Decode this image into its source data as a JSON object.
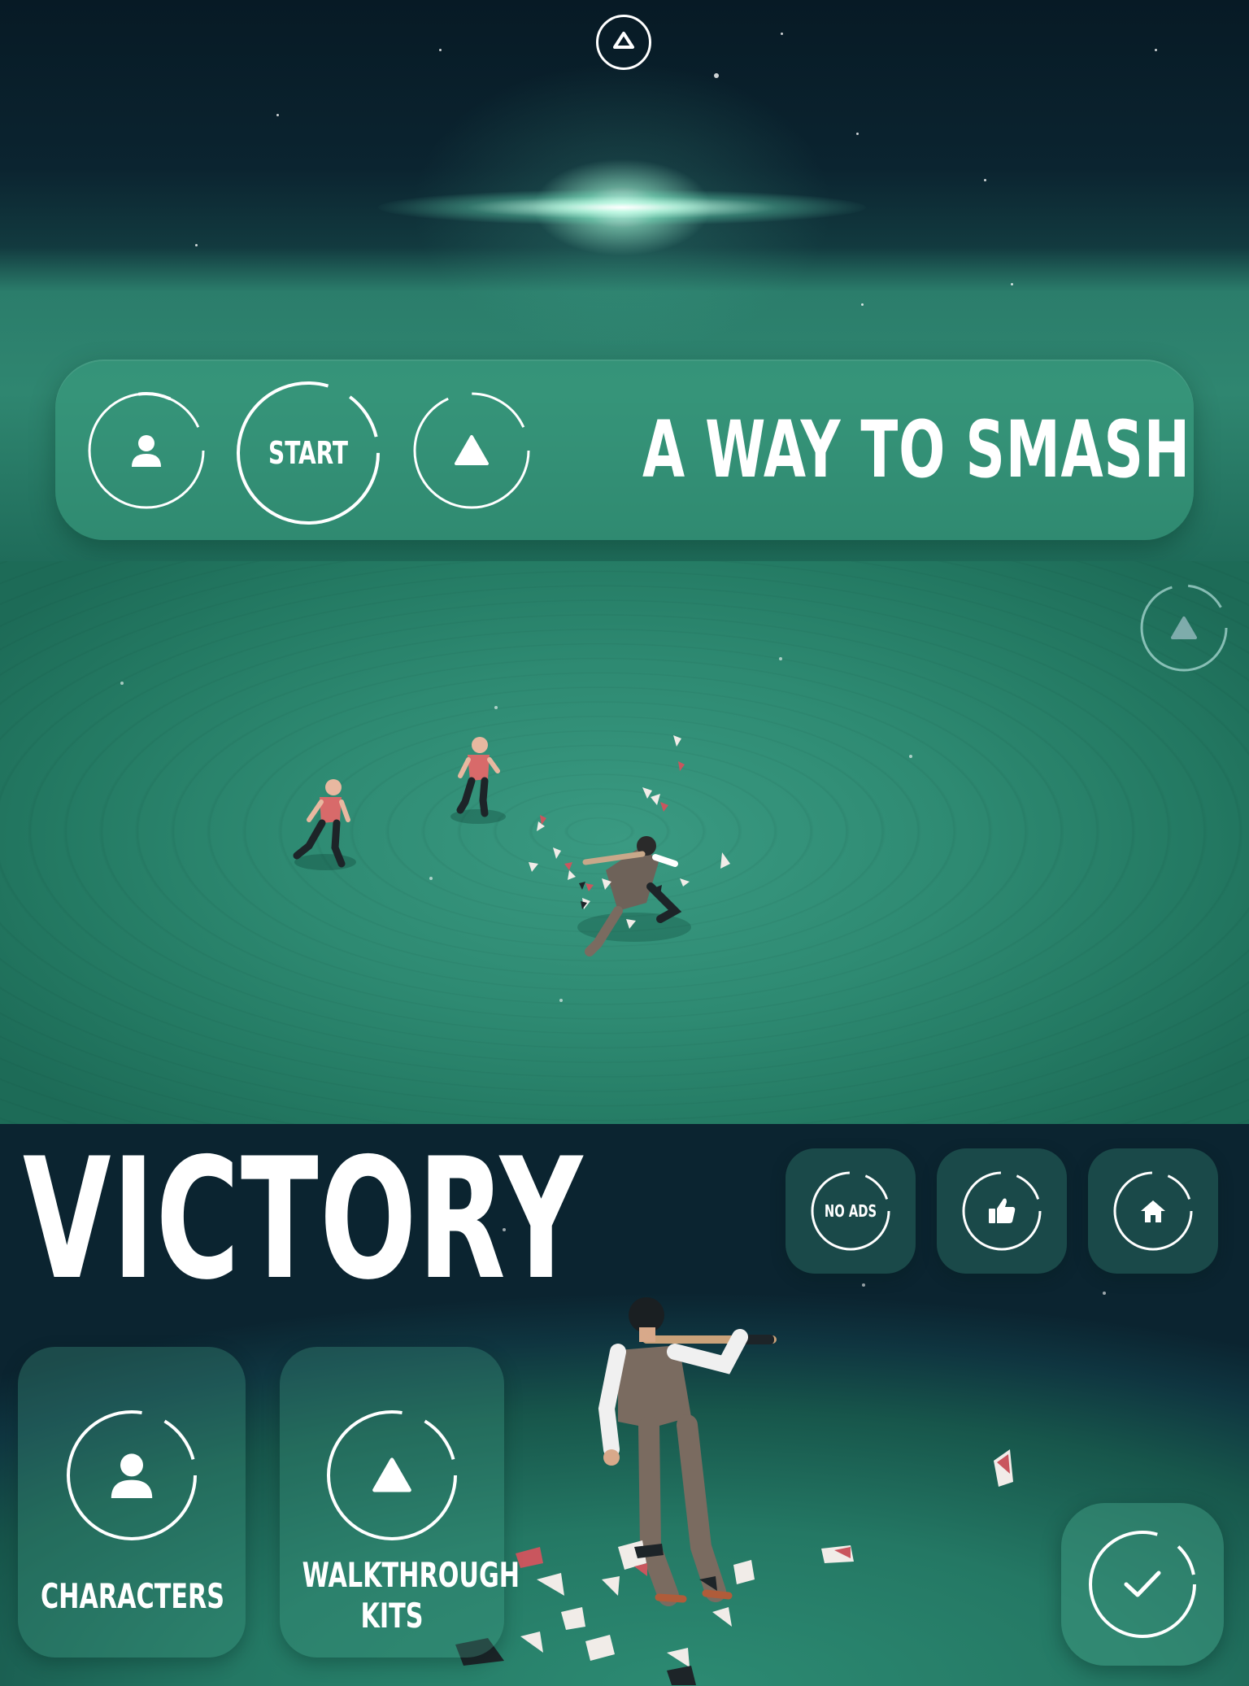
{
  "title_screen": {
    "game_title": "A WAY TO SMASH",
    "start_label": "START",
    "icons": {
      "top": "game-logo-icon",
      "left": "character-icon",
      "right": "kit-triangle-icon"
    }
  },
  "arena": {
    "icons": {
      "corner": "kit-triangle-icon"
    }
  },
  "victory_screen": {
    "heading": "VICTORY",
    "no_ads_label": "NO ADS",
    "characters_label": "CHARACTERS",
    "walkthrough_label": "WALKTHROUGH\nKITS",
    "icons": {
      "like": "thumbs-up-icon",
      "home": "home-icon",
      "characters": "character-icon",
      "walkthrough": "kit-triangle-icon",
      "confirm": "checkmark-icon"
    }
  },
  "colors": {
    "sky": "#071a25",
    "teal": "#2f8670",
    "ring": "#ffffff"
  }
}
